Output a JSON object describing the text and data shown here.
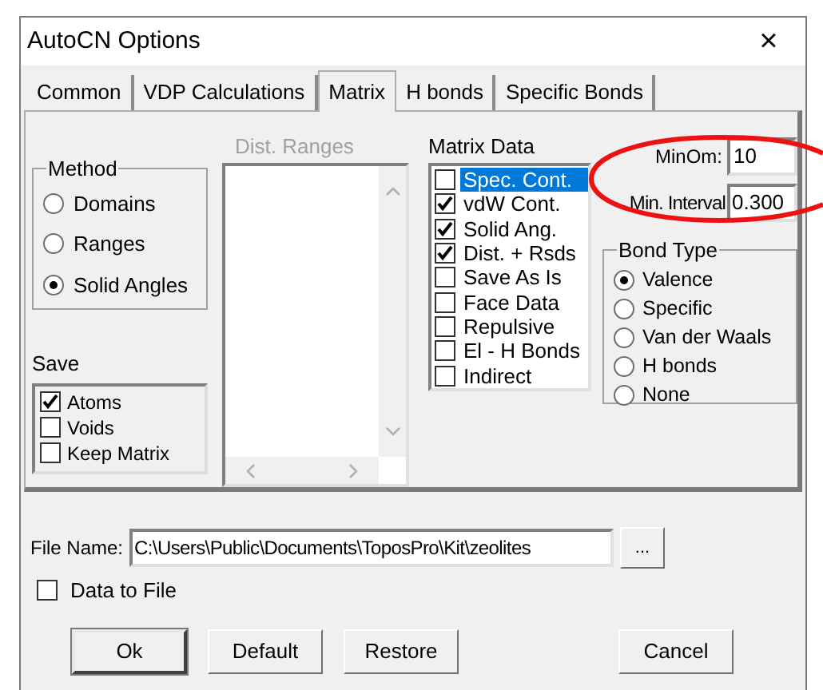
{
  "window": {
    "title": "AutoCN Options",
    "close": "×"
  },
  "tabs": [
    {
      "label": "Common",
      "selected": false
    },
    {
      "label": "VDP Calculations",
      "selected": false
    },
    {
      "label": "Matrix",
      "selected": true
    },
    {
      "label": "H bonds",
      "selected": false
    },
    {
      "label": "Specific Bonds",
      "selected": false
    }
  ],
  "method": {
    "title": "Method",
    "options": [
      {
        "label": "Domains",
        "selected": false
      },
      {
        "label": "Ranges",
        "selected": false
      },
      {
        "label": "Solid Angles",
        "selected": true
      }
    ]
  },
  "save": {
    "title": "Save",
    "items": [
      {
        "label": "Atoms",
        "checked": true
      },
      {
        "label": "Voids",
        "checked": false
      },
      {
        "label": "Keep Matrix",
        "checked": false
      }
    ]
  },
  "dist_ranges": {
    "label": "Dist. Ranges",
    "disabled": true
  },
  "matrix_data": {
    "label": "Matrix Data",
    "items": [
      {
        "label": "Spec. Cont.",
        "checked": false,
        "selected": true
      },
      {
        "label": "vdW Cont.",
        "checked": true,
        "selected": false
      },
      {
        "label": "Solid Ang.",
        "checked": true,
        "selected": false
      },
      {
        "label": "Dist. + Rsds",
        "checked": true,
        "selected": false
      },
      {
        "label": "Save As Is",
        "checked": false,
        "selected": false
      },
      {
        "label": "Face Data",
        "checked": false,
        "selected": false
      },
      {
        "label": "Repulsive",
        "checked": false,
        "selected": false
      },
      {
        "label": "El - H Bonds",
        "checked": false,
        "selected": false
      },
      {
        "label": "Indirect",
        "checked": false,
        "selected": false
      }
    ]
  },
  "min_om": {
    "label": "MinOm:",
    "value": "10"
  },
  "min_interval": {
    "label": "Min. Interval",
    "value": "0.300"
  },
  "bond_type": {
    "title": "Bond Type",
    "options": [
      {
        "label": "Valence",
        "selected": true
      },
      {
        "label": "Specific",
        "selected": false
      },
      {
        "label": "Van der Waals",
        "selected": false
      },
      {
        "label": "H bonds",
        "selected": false
      },
      {
        "label": "None",
        "selected": false
      }
    ]
  },
  "file_name": {
    "label": "File Name:",
    "value": "C:\\Users\\Public\\Documents\\ToposPro\\Kit\\zeolites",
    "browse": "..."
  },
  "data_to_file": {
    "label": "Data to File",
    "checked": false
  },
  "buttons": [
    {
      "label": "Ok",
      "default": true
    },
    {
      "label": "Default",
      "default": false
    },
    {
      "label": "Restore",
      "default": false
    },
    {
      "label": "Cancel",
      "default": false
    }
  ]
}
